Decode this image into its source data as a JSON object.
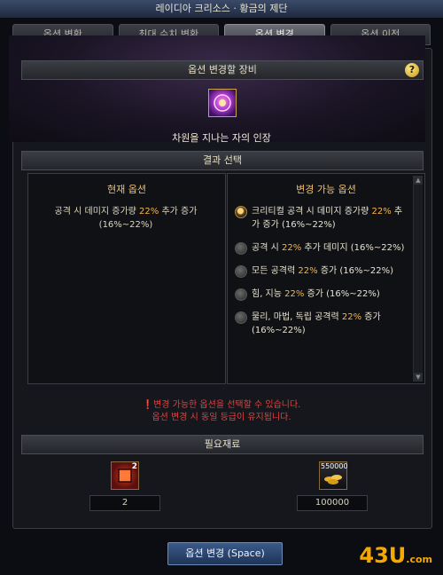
{
  "window": {
    "title": "레이디아 크리소스 · 황금의 제단"
  },
  "tabs": [
    {
      "label": "옵션 변환",
      "active": false
    },
    {
      "label": "최대 수치 변환",
      "active": false
    },
    {
      "label": "옵션 변경",
      "active": true
    },
    {
      "label": "옵션 이전",
      "active": false
    }
  ],
  "equipment": {
    "header": "옵션 변경할 장비",
    "help": "?",
    "item_name": "차원을 지나는 자의 인장"
  },
  "result": {
    "header": "결과 선택"
  },
  "current_options": {
    "title": "현재 옵션",
    "text_pre": "공격 시 데미지 증가량 ",
    "text_value": "22%",
    "text_post": " 추가 증가 (16%~22%)"
  },
  "changeable_options": {
    "title": "변경 가능 옵션",
    "items": [
      {
        "pre": "크리티컬 공격 시 데미지 증가량 ",
        "value": "22%",
        "post": " 추가 증가 (16%~22%)",
        "selected": true
      },
      {
        "pre": "공격 시 ",
        "value": "22%",
        "post": " 추가 데미지 (16%~22%)",
        "selected": false
      },
      {
        "pre": "모든 공격력 ",
        "value": "22%",
        "post": " 증가 (16%~22%)",
        "selected": false
      },
      {
        "pre": "힘, 지능 ",
        "value": "22%",
        "post": " 증가 (16%~22%)",
        "selected": false
      },
      {
        "pre": "물리, 마법, 독립 공격력 ",
        "value": "22%",
        "post": " 증가 (16%~22%)",
        "selected": false
      }
    ]
  },
  "notice": {
    "icon": "exclamation-icon",
    "line1": "변경 가능한 옵션을 선택할 수 있습니다.",
    "line2": "옵션 변경 시 동일 등급이 유지됩니다."
  },
  "materials": {
    "header": "필요재료",
    "items": [
      {
        "badge": "2",
        "count": "2",
        "icon": "cube-icon"
      },
      {
        "badge": "550000",
        "count": "100000",
        "icon": "gold-coins-icon"
      }
    ]
  },
  "action_button": {
    "label": "옵션 변경 (Space)"
  },
  "watermark": {
    "text": "43U",
    "suffix": ".com"
  },
  "colors": {
    "highlight": "#f5b44a",
    "title_gold": "#f2c16a",
    "notice_red": "#e04040"
  }
}
